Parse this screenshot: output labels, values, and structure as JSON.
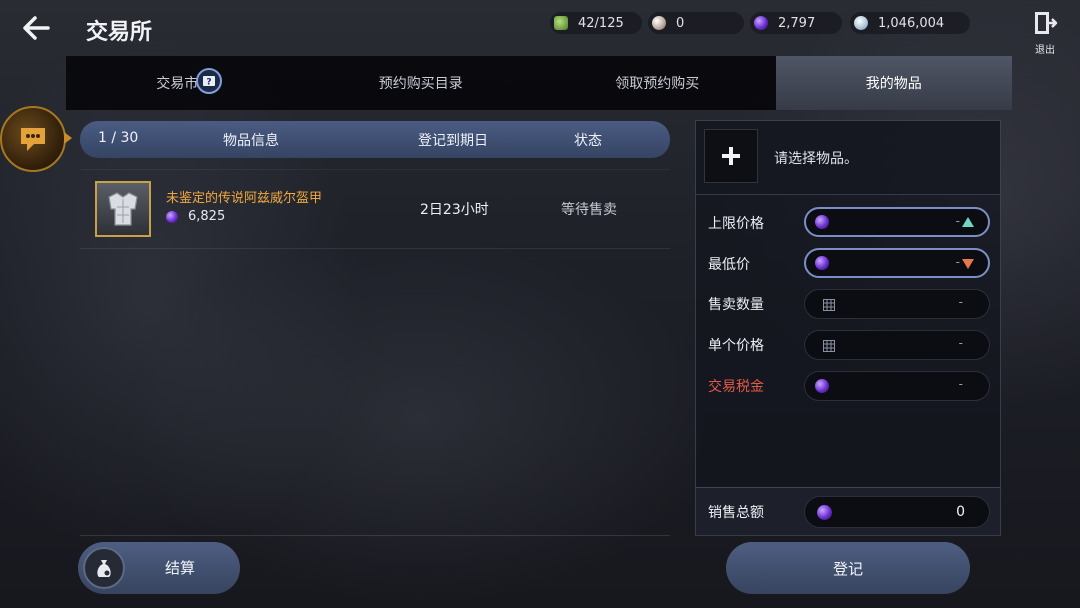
{
  "header": {
    "title": "交易所",
    "exit_label": "退出"
  },
  "currencies": {
    "ap": "42/125",
    "pearl": "0",
    "gem": "2,797",
    "silver": "1,046,004"
  },
  "tabs": [
    {
      "label": "交易市场"
    },
    {
      "label": "预约购买目录"
    },
    {
      "label": "领取预约购买"
    },
    {
      "label": "我的物品",
      "active": true
    }
  ],
  "list": {
    "count": "1 / 30",
    "col_info": "物品信息",
    "col_date": "登记到期日",
    "col_status": "状态",
    "rows": [
      {
        "name": "未鉴定的传说阿兹威尔盔甲",
        "price": "6,825",
        "time_left": "2日23小时",
        "status": "等待售卖"
      }
    ]
  },
  "settle": {
    "label": "结算"
  },
  "panel": {
    "hint": "请选择物品。",
    "max_price_label": "上限价格",
    "max_price_value": "-",
    "min_price_label": "最低价",
    "min_price_value": "-",
    "qty_label": "售卖数量",
    "qty_value": "-",
    "unit_price_label": "单个价格",
    "unit_price_value": "-",
    "tax_label": "交易税金",
    "tax_value": "-",
    "total_label": "销售总额",
    "total_value": "0"
  },
  "register": {
    "label": "登记"
  },
  "colors": {
    "accent": "#4b5c83",
    "item_name": "#f0a93c",
    "tax_label": "#e15a47",
    "arrow_up": "#6fd6c4",
    "arrow_down": "#e8774b"
  }
}
